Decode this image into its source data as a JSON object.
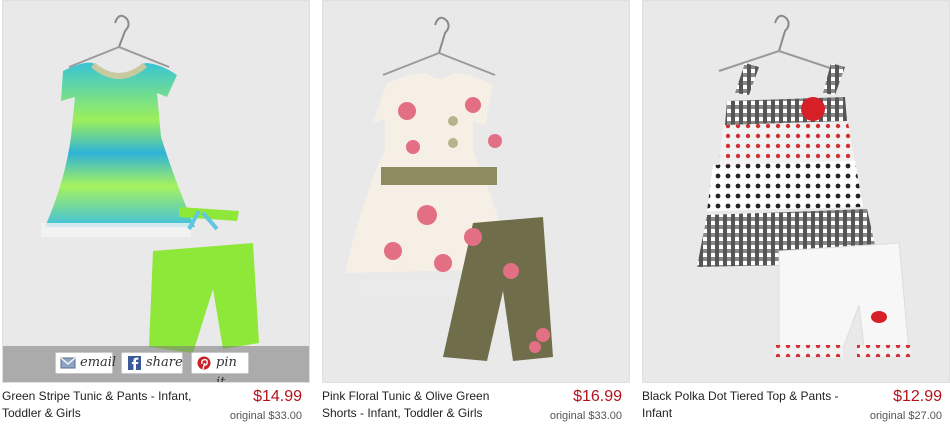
{
  "products": [
    {
      "title": "Green Stripe Tunic & Pants - Infant, Toddler & Girls",
      "price": "$14.99",
      "original": "original $33.00",
      "colors": {
        "top": "#4dd0c8",
        "pants": "#8ee83a"
      },
      "image_icon": "green-stripe-tunic-set-photo",
      "share_buttons": [
        {
          "label": "email",
          "icon": "envelope-icon"
        },
        {
          "label": "share",
          "icon": "facebook-icon"
        },
        {
          "label": "pin it",
          "icon": "pinterest-icon"
        }
      ]
    },
    {
      "title": "Pink Floral Tunic & Olive Green Shorts - Infant, Toddler & Girls",
      "price": "$16.99",
      "original": "original $33.00",
      "colors": {
        "top": "#f6efe6",
        "pants": "#6f6d4a"
      },
      "image_icon": "pink-floral-tunic-set-photo"
    },
    {
      "title": "Black Polka Dot Tiered Top & Pants - Infant",
      "price": "$12.99",
      "original": "original $27.00",
      "colors": {
        "top": "#333333",
        "pants": "#f7f7f7"
      },
      "image_icon": "black-polka-dot-top-set-photo"
    }
  ],
  "accent": {
    "price": "#b0131b",
    "facebook": "#3b5998",
    "pinterest": "#cb2027"
  }
}
